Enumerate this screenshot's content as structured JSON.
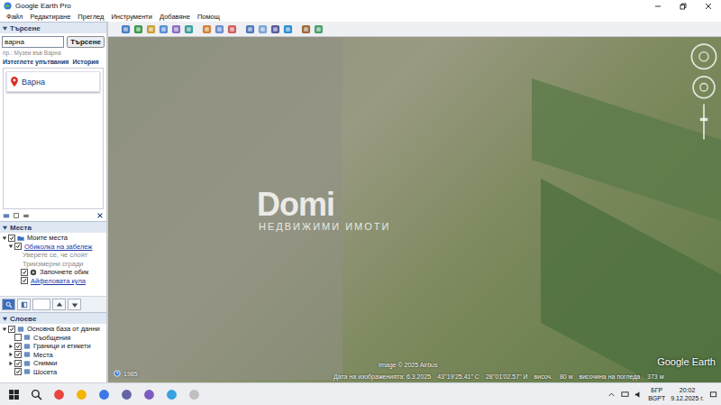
{
  "window": {
    "title": "Google Earth Pro"
  },
  "menu": [
    "Файл",
    "Редактиране",
    "Преглед",
    "Инструменти",
    "Добавяне",
    "Помощ"
  ],
  "search": {
    "title": "Търсене",
    "expanded": true,
    "query": "варна",
    "button": "Търсене",
    "hint": "пр.: Музеи във Варна",
    "links": [
      "Изтеглете упътвания",
      "История"
    ],
    "results": [
      {
        "label": "Варна",
        "selected": false
      }
    ]
  },
  "places": {
    "title": "Места",
    "expanded": true,
    "items": [
      {
        "label": "Моите места",
        "kind": "folder",
        "depth": 0,
        "checked": true,
        "expanded": true
      },
      {
        "label": "Обиколка на забележ",
        "kind": "link",
        "depth": 1,
        "checked": true,
        "expanded": true
      },
      {
        "label": "Уверете се, че слоят",
        "kind": "note",
        "depth": 2,
        "checked": false,
        "expanded": false
      },
      {
        "label": "Триизмерни сгради",
        "kind": "note",
        "depth": 2,
        "checked": false,
        "expanded": false
      },
      {
        "label": "Започнете обик",
        "kind": "tour",
        "depth": 2,
        "checked": true,
        "expanded": false
      },
      {
        "label": "Айфеловата кула",
        "kind": "link",
        "depth": 2,
        "checked": true,
        "expanded": false
      }
    ]
  },
  "layers": {
    "title": "Слоеве",
    "expanded": true,
    "items": [
      {
        "label": "Основна база от данни",
        "depth": 0,
        "checked": true,
        "expandable": true,
        "expanded": true
      },
      {
        "label": "Съобщения",
        "depth": 1,
        "checked": false,
        "expandable": false,
        "expanded": false
      },
      {
        "label": "Граници и етикети",
        "depth": 1,
        "checked": true,
        "expandable": true,
        "expanded": false
      },
      {
        "label": "Места",
        "depth": 1,
        "checked": true,
        "expandable": true,
        "expanded": false
      },
      {
        "label": "Снимки",
        "depth": 1,
        "checked": true,
        "expandable": true,
        "expanded": false
      },
      {
        "label": "Шосета",
        "depth": 1,
        "checked": true,
        "expandable": false,
        "expanded": false
      }
    ]
  },
  "map": {
    "watermark": {
      "logo": "Domi",
      "caption": "НЕДВИЖИМИ ИМОТИ"
    },
    "year": "1985",
    "attribution": "Image © 2025 Airbus",
    "logo": "Google Earth",
    "status": [
      "Дата на изображенията: 6.3.2025",
      "43°19'25.41\" С",
      "28°01'02.57\" И",
      "височ.    80 м",
      "височина на погледа    373 м"
    ]
  },
  "taskbar": {
    "lang": "БГР",
    "layout": "BGPT",
    "time": "20:02",
    "date": "9.12.2025 г."
  }
}
